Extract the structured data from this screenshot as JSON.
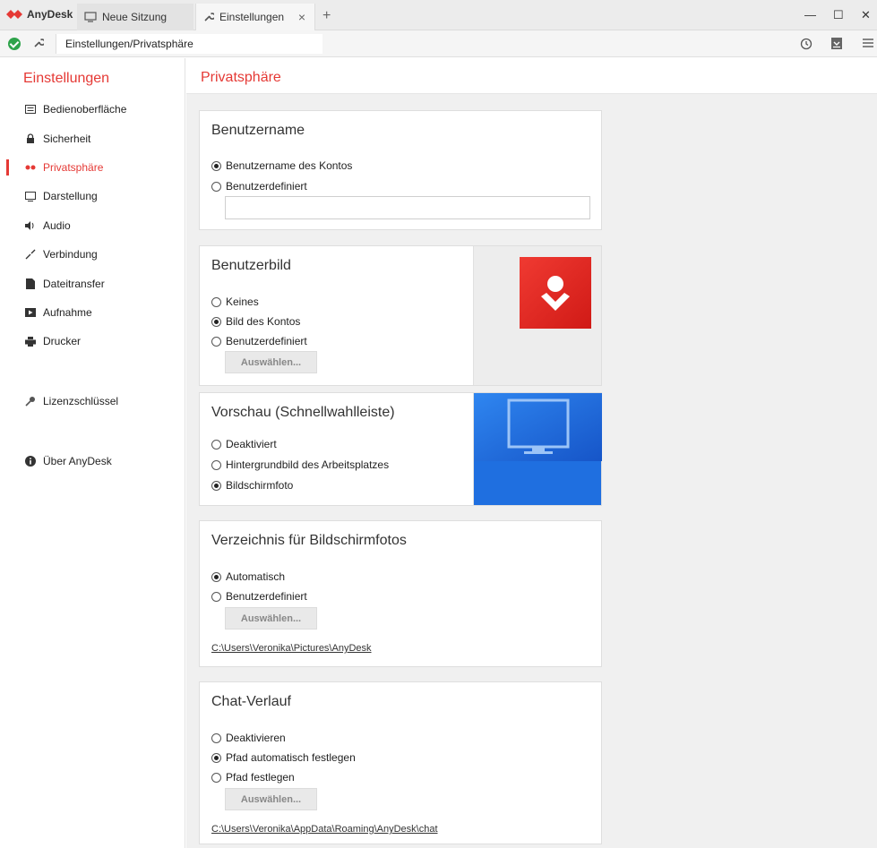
{
  "app": {
    "brand": "AnyDesk",
    "accent": "#e53935"
  },
  "tabs": [
    {
      "label": "Neue Sitzung",
      "icon": "monitor-icon"
    },
    {
      "label": "Einstellungen",
      "icon": "wrench-icon"
    }
  ],
  "address": {
    "path": "Einstellungen/Privatsphäre"
  },
  "sidebar": {
    "title": "Einstellungen",
    "items": [
      {
        "label": "Bedienoberfläche",
        "icon": "keyboard-icon"
      },
      {
        "label": "Sicherheit",
        "icon": "lock-icon"
      },
      {
        "label": "Privatsphäre",
        "icon": "glasses-icon"
      },
      {
        "label": "Darstellung",
        "icon": "display-icon"
      },
      {
        "label": "Audio",
        "icon": "speaker-icon"
      },
      {
        "label": "Verbindung",
        "icon": "connection-icon"
      },
      {
        "label": "Dateitransfer",
        "icon": "file-icon"
      },
      {
        "label": "Aufnahme",
        "icon": "record-icon"
      },
      {
        "label": "Drucker",
        "icon": "printer-icon"
      },
      {
        "label": "Lizenzschlüssel",
        "icon": "key-icon"
      },
      {
        "label": "Über AnyDesk",
        "icon": "info-icon"
      }
    ]
  },
  "main": {
    "title": "Privatsphäre"
  },
  "cards": {
    "username": {
      "title": "Benutzername",
      "opt1": "Benutzername des Kontos",
      "opt2": "Benutzerdefiniert",
      "input_value": ""
    },
    "userpic": {
      "title": "Benutzerbild",
      "opt1": "Keines",
      "opt2": "Bild des Kontos",
      "opt3": "Benutzerdefiniert",
      "button": "Auswählen..."
    },
    "preview": {
      "title": "Vorschau (Schnellwahlleiste)",
      "opt1": "Deaktiviert",
      "opt2": "Hintergrundbild des Arbeitsplatzes",
      "opt3": "Bildschirmfoto"
    },
    "screenshots": {
      "title": "Verzeichnis für Bildschirmfotos",
      "opt1": "Automatisch",
      "opt2": "Benutzerdefiniert",
      "button": "Auswählen...",
      "path": "C:\\Users\\Veronika\\Pictures\\AnyDesk"
    },
    "chat": {
      "title": "Chat-Verlauf",
      "opt1": "Deaktivieren",
      "opt2": "Pfad automatisch festlegen",
      "opt3": "Pfad festlegen",
      "button": "Auswählen...",
      "path": "C:\\Users\\Veronika\\AppData\\Roaming\\AnyDesk\\chat"
    }
  }
}
